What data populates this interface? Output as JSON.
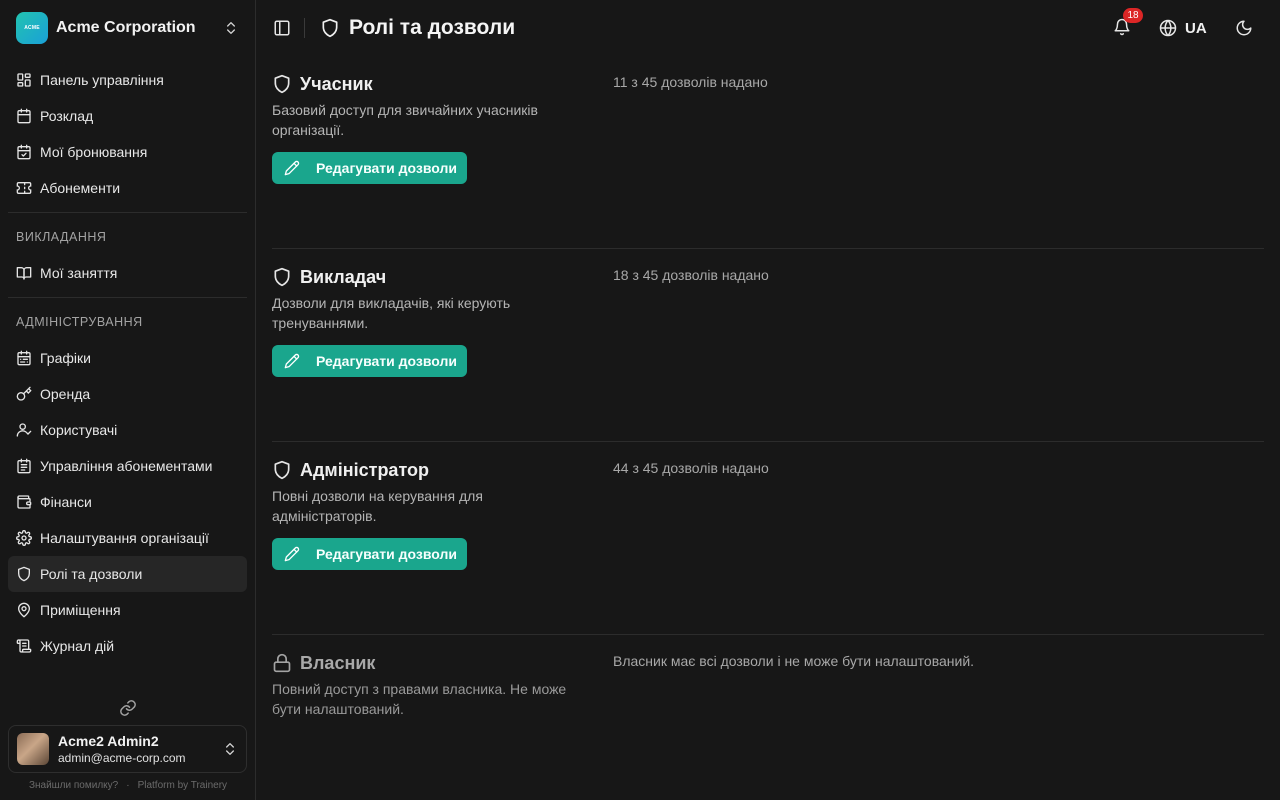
{
  "org": {
    "name": "Acme Corporation",
    "logo_text": "ACME"
  },
  "nav": {
    "main": [
      {
        "label": "Панель управління",
        "icon": "dashboard-icon"
      },
      {
        "label": "Розклад",
        "icon": "calendar-icon"
      },
      {
        "label": "Мої бронювання",
        "icon": "calendar-check-icon"
      },
      {
        "label": "Абонементи",
        "icon": "ticket-icon"
      }
    ],
    "teaching_group": "ВИКЛАДАННЯ",
    "teaching": [
      {
        "label": "Мої заняття",
        "icon": "book-open-icon"
      }
    ],
    "admin_group": "АДМІНІСТРУВАННЯ",
    "admin": [
      {
        "label": "Графіки",
        "icon": "calendar-range-icon"
      },
      {
        "label": "Оренда",
        "icon": "key-icon"
      },
      {
        "label": "Користувачі",
        "icon": "users-icon"
      },
      {
        "label": "Управління абонементами",
        "icon": "list-icon"
      },
      {
        "label": "Фінанси",
        "icon": "wallet-icon"
      },
      {
        "label": "Налаштування організації",
        "icon": "gear-icon"
      },
      {
        "label": "Ролі та дозволи",
        "icon": "shield-icon",
        "active": true
      },
      {
        "label": "Приміщення",
        "icon": "map-pin-icon"
      },
      {
        "label": "Журнал дій",
        "icon": "scroll-icon"
      }
    ]
  },
  "user": {
    "name": "Acme2 Admin2",
    "email": "admin@acme-corp.com"
  },
  "footer": {
    "bug_link": "Знайшли помилку?",
    "separator": "·",
    "platform": "Platform by Trainery"
  },
  "header": {
    "title": "Ролі та дозволи",
    "notifications_count": "18",
    "language": "UA"
  },
  "roles": [
    {
      "name": "Учасник",
      "description": "Базовий доступ для звичайних учасників організації.",
      "permissions": "11 з 45 дозволів надано",
      "edit_label": "Редагувати дозволи"
    },
    {
      "name": "Викладач",
      "description": "Дозволи для викладачів, які керують тренуваннями.",
      "permissions": "18 з 45 дозволів надано",
      "edit_label": "Редагувати дозволи"
    },
    {
      "name": "Адміністратор",
      "description": "Повні дозволи на керування для адміністраторів.",
      "permissions": "44 з 45 дозволів надано",
      "edit_label": "Редагувати дозволи"
    },
    {
      "name": "Власник",
      "description": "Повний доступ з правами власника. Не може бути налаштований.",
      "permissions": "Власник має всі дозволи і не може бути налаштований."
    }
  ],
  "colors": {
    "accent": "#1aa68d",
    "badge": "#dc2626",
    "background": "#171717"
  }
}
